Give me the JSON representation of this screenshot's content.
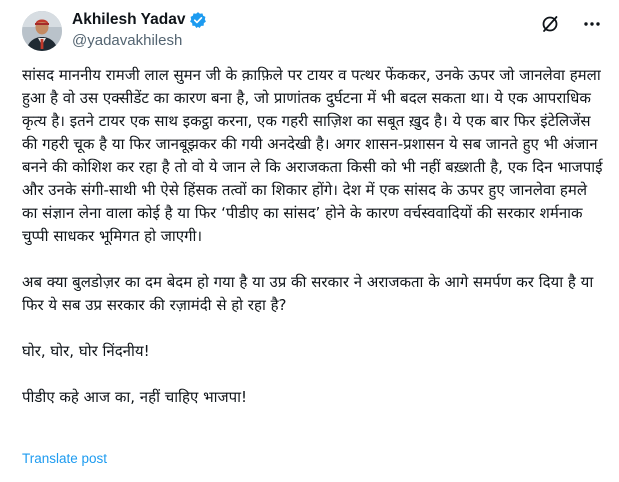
{
  "author": {
    "display_name": "Akhilesh Yadav",
    "handle": "@yadavakhilesh",
    "verified": true,
    "avatar_icon": "profile-photo"
  },
  "header_actions": {
    "grok_icon": "slash-circle-icon",
    "more_icon": "more-dots-icon"
  },
  "tweet": {
    "paragraphs": [
      "सांसद माननीय रामजी लाल सुमन जी के क़ाफ़िले पर टायर व पत्थर फेंककर, उनके ऊपर जो जानलेवा हमला हुआ है वो उस एक्सीडेंट का कारण बना है, जो प्राणांतक दुर्घटना में भी बदल सकता था। ये एक आपराधिक कृत्य है। इतने टायर एक साथ इकट्ठा करना, एक गहरी साज़िश का सबूत ख़ुद है। ये एक बार फिर इंटेलिजेंस की गहरी चूक है या फिर जानबूझकर की गयी अनदेखी है। अगर शासन-प्रशासन ये सब जानते हुए भी अंजान बनने की कोशिश कर रहा है तो वो ये जान ले कि अराजकता किसी को भी नहीं बख़्शती है, एक दिन भाजपाई और उनके संगी-साथी भी ऐसे हिंसक तत्वों का शिकार होंगे। देश में एक सांसद के ऊपर हुए जानलेवा हमले का संज्ञान लेना वाला कोई है या फिर ‘पीडीए का सांसद’ होने के कारण वर्चस्ववादियों की सरकार शर्मनाक चुप्पी साधकर भूमिगत हो जाएगी।",
      "अब क्या बुलडोज़र का दम बेदम हो गया है या उप्र की सरकार ने अराजकता के आगे समर्पण कर दिया है या फिर ये सब उप्र सरकार की रज़ामंदी से हो रहा है?",
      "घोर, घोर, घोर निंदनीय!",
      "पीडीए कहे आज का, नहीं चाहिए भाजपा!"
    ],
    "translate_label": "Translate post"
  },
  "colors": {
    "text": "#0f1419",
    "secondary": "#536471",
    "accent": "#1d9bf0"
  }
}
